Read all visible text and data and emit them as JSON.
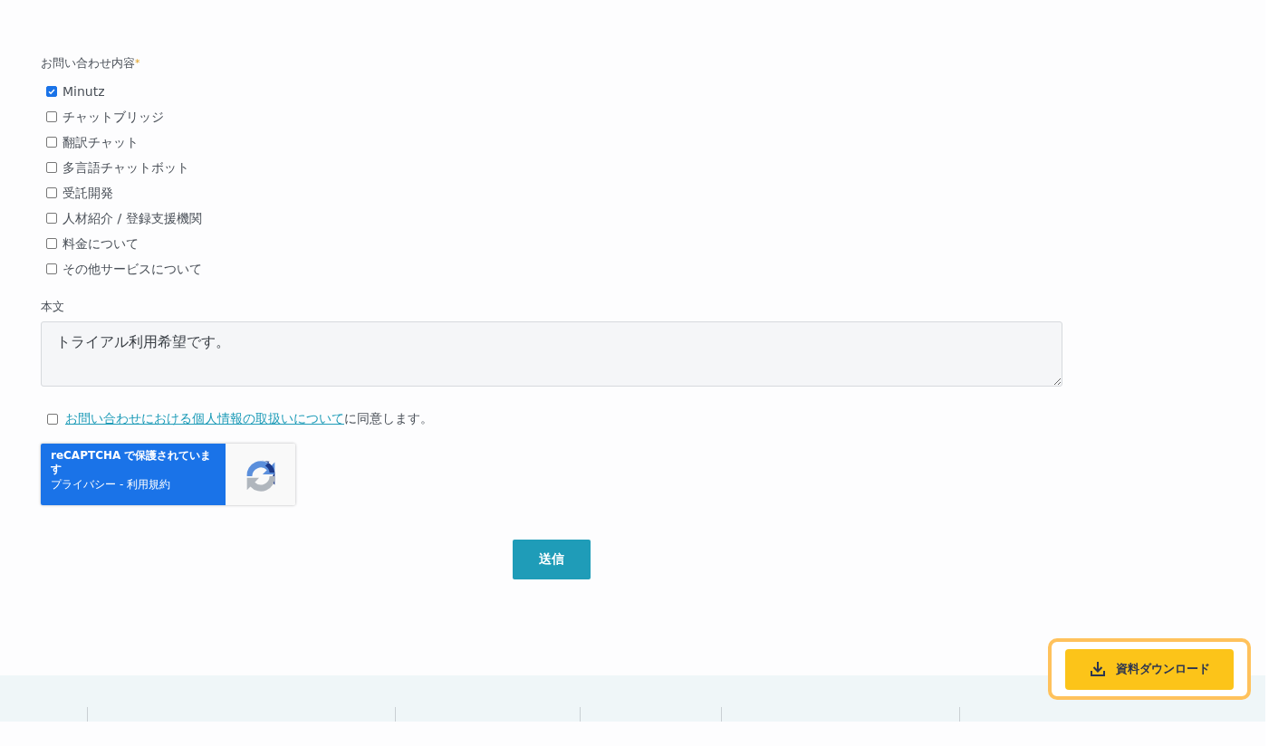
{
  "inquiry": {
    "label": "お問い合わせ内容",
    "required_mark": "*",
    "options": [
      {
        "label": "Minutz",
        "checked": true
      },
      {
        "label": "チャットブリッジ",
        "checked": false
      },
      {
        "label": "翻訳チャット",
        "checked": false
      },
      {
        "label": "多言語チャットボット",
        "checked": false
      },
      {
        "label": "受託開発",
        "checked": false
      },
      {
        "label": "人材紹介 / 登録支援機関",
        "checked": false
      },
      {
        "label": "料金について",
        "checked": false
      },
      {
        "label": "その他サービスについて",
        "checked": false
      }
    ]
  },
  "body": {
    "label": "本文",
    "value": "トライアル利用希望です。"
  },
  "consent": {
    "checked": false,
    "link": "お問い合わせにおける個人情報の取扱いについて",
    "text": "に同意します。"
  },
  "recaptcha": {
    "title": "reCAPTCHA で保護されています",
    "privacy": "プライバシー",
    "separator": "-",
    "terms": "利用規約"
  },
  "submit": "送信",
  "download_button": "資料ダウンロード"
}
